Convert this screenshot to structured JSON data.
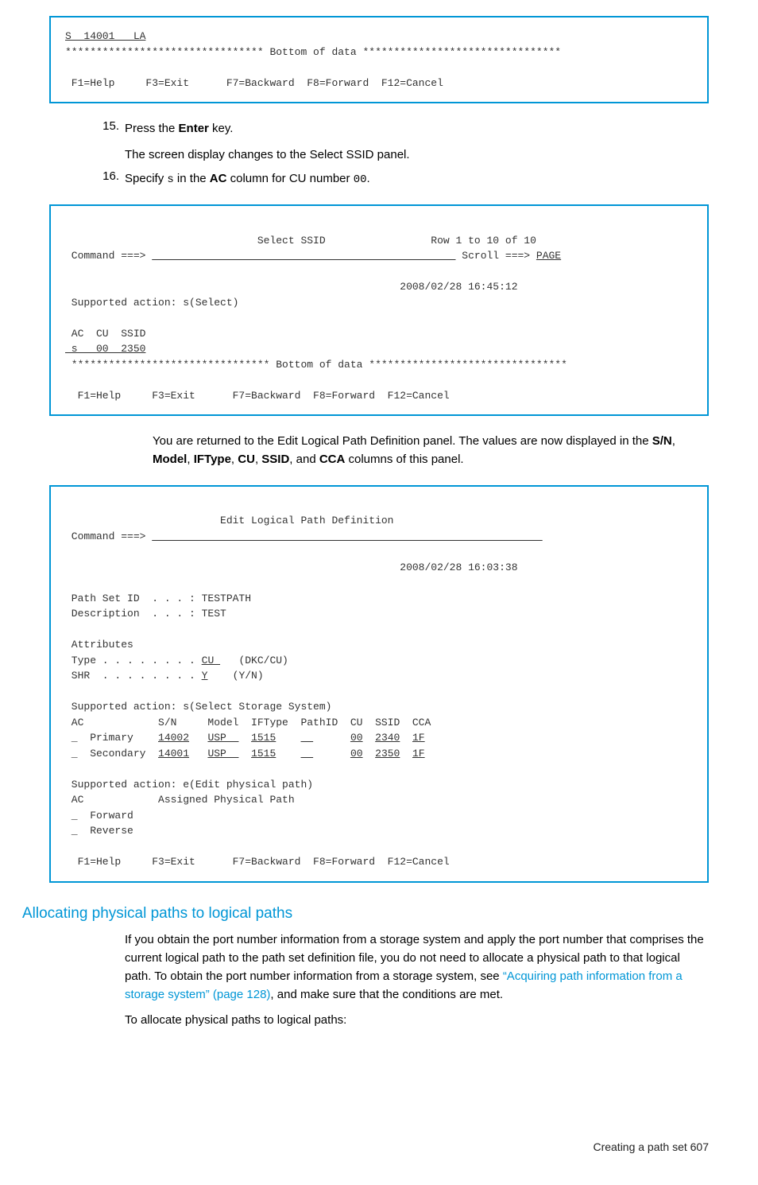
{
  "terminal1": {
    "row": "S  14001   LA",
    "bottom": "******************************** Bottom of data ********************************",
    "fkeys": " F1=Help     F3=Exit      F7=Backward  F8=Forward  F12=Cancel"
  },
  "step15": {
    "num": "15.",
    "text_a": "Press the ",
    "bold": "Enter",
    "text_b": " key.",
    "sub": "The screen display changes to the Select SSID panel."
  },
  "step16": {
    "num": "16.",
    "text_a": "Specify ",
    "mono1": "s",
    "text_b": " in the ",
    "bold": "AC",
    "text_c": " column for CU number ",
    "mono2": "00",
    "text_d": "."
  },
  "terminal2": {
    "title": "                               Select SSID                 Row 1 to 10 of 10",
    "cmd_a": " Command ===> ",
    "cmd_blank": "                                                 ",
    "scroll_a": " Scroll ===> ",
    "scroll_v": "PAGE",
    "ts": "                                                      2008/02/28 16:45:12",
    "supp": " Supported action: s(Select)",
    "hdr": " AC  CU  SSID",
    "row": " s   00  2350",
    "bottom": " ******************************** Bottom of data ********************************",
    "fkeys": "  F1=Help     F3=Exit      F7=Backward  F8=Forward  F12=Cancel"
  },
  "narrative2": {
    "a": "You are returned to the Edit Logical Path Definition panel. The values are now displayed in the ",
    "b1": "S/N",
    "c1": ", ",
    "b2": "Model",
    "c2": ", ",
    "b3": "IFType",
    "c3": ", ",
    "b4": "CU",
    "c4": ", ",
    "b5": "SSID",
    "c5": ", and ",
    "b6": "CCA",
    "c6": " columns of this panel."
  },
  "terminal3": {
    "title": "                         Edit Logical Path Definition",
    "cmd_a": " Command ===> ",
    "cmd_blank": "                                                               ",
    "ts": "                                                      2008/02/28 16:03:38",
    "p1": " Path Set ID  . . . : TESTPATH",
    "p2": " Description  . . . : TEST",
    "attr": " Attributes",
    "type_a": " Type . . . . . . . . ",
    "type_v": "CU ",
    "type_b": "   (DKC/CU)",
    "shr_a": " SHR  . . . . . . . . ",
    "shr_v": "Y",
    "shr_b": "    (Y/N)",
    "supp1": " Supported action: s(Select Storage System)",
    "hdr": " AC            S/N     Model  IFType  PathID  CU  SSID  CCA",
    "pri_a": " _  Primary    ",
    "pri_sn": "14002",
    "pri_sp1": "   ",
    "pri_md": "USP  ",
    "pri_sp2": "  ",
    "pri_if": "1515",
    "pri_sp3": "    ",
    "pri_pi": "  ",
    "pri_sp4": "      ",
    "pri_cu": "00",
    "pri_sp5": "  ",
    "pri_ss": "2340",
    "pri_sp6": "  ",
    "pri_cc": "1F",
    "sec_a": " _  Secondary  ",
    "sec_sn": "14001",
    "sec_sp1": "   ",
    "sec_md": "USP  ",
    "sec_sp2": "  ",
    "sec_if": "1515",
    "sec_sp3": "    ",
    "sec_pi": "  ",
    "sec_sp4": "      ",
    "sec_cu": "00",
    "sec_sp5": "  ",
    "sec_ss": "2350",
    "sec_sp6": "  ",
    "sec_cc": "1F",
    "supp2": " Supported action: e(Edit physical path)",
    "phdr": " AC            Assigned Physical Path",
    "fwd": " _  Forward",
    "rev": " _  Reverse",
    "fkeys": "  F1=Help     F3=Exit      F7=Backward  F8=Forward  F12=Cancel"
  },
  "section": {
    "heading": "Allocating physical paths to logical paths",
    "p1_a": "If you obtain the port number information from a storage system and apply the port number that comprises the current logical path to the path set definition file, you do not need to allocate a physical path to that logical path. To obtain the port number information from a storage system, see ",
    "link": "“Acquiring path information from a storage system” (page 128)",
    "p1_b": ", and make sure that the conditions are met.",
    "p2": "To allocate physical paths to logical paths:"
  },
  "footer": {
    "a": "Creating a path set",
    "b": "   607"
  }
}
